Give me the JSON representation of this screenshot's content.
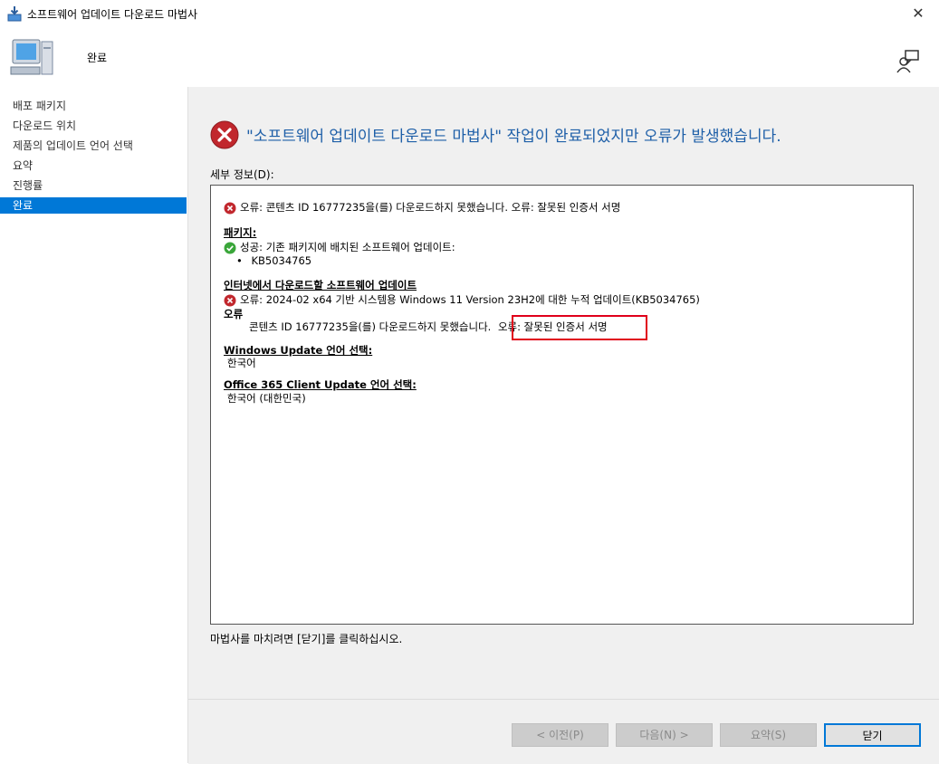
{
  "window": {
    "title": "소프트웨어 업데이트 다운로드 마법사",
    "close_glyph": "✕"
  },
  "header": {
    "page_heading": "완료"
  },
  "sidebar": {
    "items": [
      {
        "label": "배포 패키지"
      },
      {
        "label": "다운로드 위치"
      },
      {
        "label": "제품의 업데이트 언어 선택"
      },
      {
        "label": "요약"
      },
      {
        "label": "진행률"
      },
      {
        "label": "완료"
      }
    ],
    "selected_index": 5
  },
  "main": {
    "status_message": "\"소프트웨어 업데이트 다운로드 마법사\" 작업이 완료되었지만 오류가 발생했습니다.",
    "details_label": "세부 정보(D):",
    "details": {
      "line1": "오류: 콘텐츠 ID 16777235을(를) 다운로드하지 못했습니다. 오류: 잘못된 인증서 서명",
      "packages_heading": "패키지:",
      "success_line": "성공: 기존 패키지에 배치된 소프트웨어 업데이트:",
      "kb_bullet": "•",
      "kb_item": "KB5034765",
      "internet_heading": "인터넷에서 다운로드할 소프트웨어 업데이트",
      "error_update_line": "오류: 2024-02 x64 기반 시스템용 Windows 11 Version 23H2에 대한 누적 업데이트(KB5034765)",
      "error_label": "오류",
      "error_detail_part1": "콘텐츠 ID 16777235을(를) 다운로드하지 못했습니다.",
      "error_detail_part2": "오류: 잘못된 인증서 서명",
      "wu_lang_heading": "Windows Update 언어 선택:",
      "wu_lang_value": "한국어",
      "o365_lang_heading": "Office 365 Client Update 언어 선택:",
      "o365_lang_value": "한국어 (대한민국)"
    },
    "finish_hint": "마법사를 마치려면 [닫기]를 클릭하십시오."
  },
  "buttons": {
    "prev": "< 이전(P)",
    "next": "다음(N) >",
    "summary": "요약(S)",
    "close": "닫기"
  },
  "colors": {
    "accent": "#0078d7",
    "status_text": "#1e5fa8",
    "error_red": "#c1272d",
    "success_green": "#3aa63a",
    "highlight_red": "#e0001a"
  }
}
